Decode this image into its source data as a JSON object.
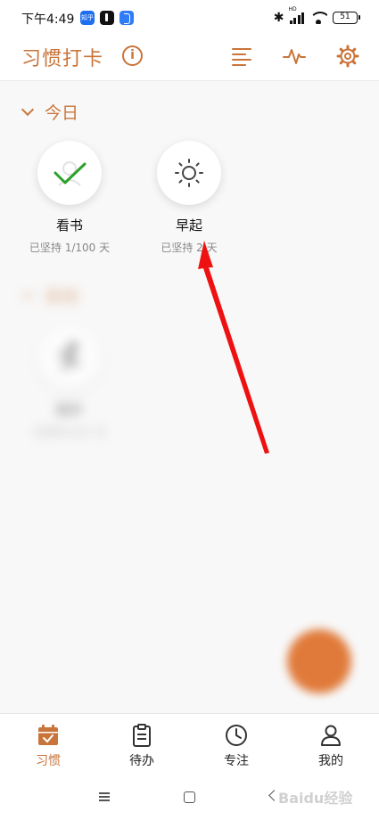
{
  "status_bar": {
    "time": "下午4:49",
    "app_icons": [
      "zhihu-icon",
      "tiktok-icon",
      "bluetooth-app-icon"
    ],
    "zhihu_text": "知乎",
    "network_label": "HD",
    "battery": "51"
  },
  "header": {
    "title": "习惯打卡",
    "icons": [
      "info-icon",
      "list-icon",
      "activity-icon",
      "gear-icon"
    ]
  },
  "sections": {
    "today": {
      "label": "今日",
      "habits": [
        {
          "name": "看书",
          "progress": "已坚持 1/100 天",
          "icon": "check-icon",
          "done": true
        },
        {
          "name": "早起",
          "progress": "已坚持 2 天",
          "icon": "sun-icon",
          "done": false
        }
      ]
    },
    "other": {
      "label": "其他",
      "habits": [
        {
          "name": "跑步",
          "progress": "已坚持 0/21 天",
          "icon": "run-icon",
          "done": false
        }
      ]
    }
  },
  "fab": {
    "icon": "plus-icon"
  },
  "bottom_nav": {
    "items": [
      {
        "label": "习惯",
        "icon": "calendar-icon",
        "active": true
      },
      {
        "label": "待办",
        "icon": "clipboard-icon",
        "active": false
      },
      {
        "label": "专注",
        "icon": "clock-icon",
        "active": false
      },
      {
        "label": "我的",
        "icon": "person-icon",
        "active": false
      }
    ]
  },
  "system_nav": {
    "icons": [
      "menu-icon",
      "home-icon",
      "back-icon"
    ]
  },
  "watermark": "Baidu经验",
  "colors": {
    "accent": "#c9743a",
    "fab": "#e07a3a",
    "check": "#2aa12a",
    "arrow": "#ee1111"
  }
}
